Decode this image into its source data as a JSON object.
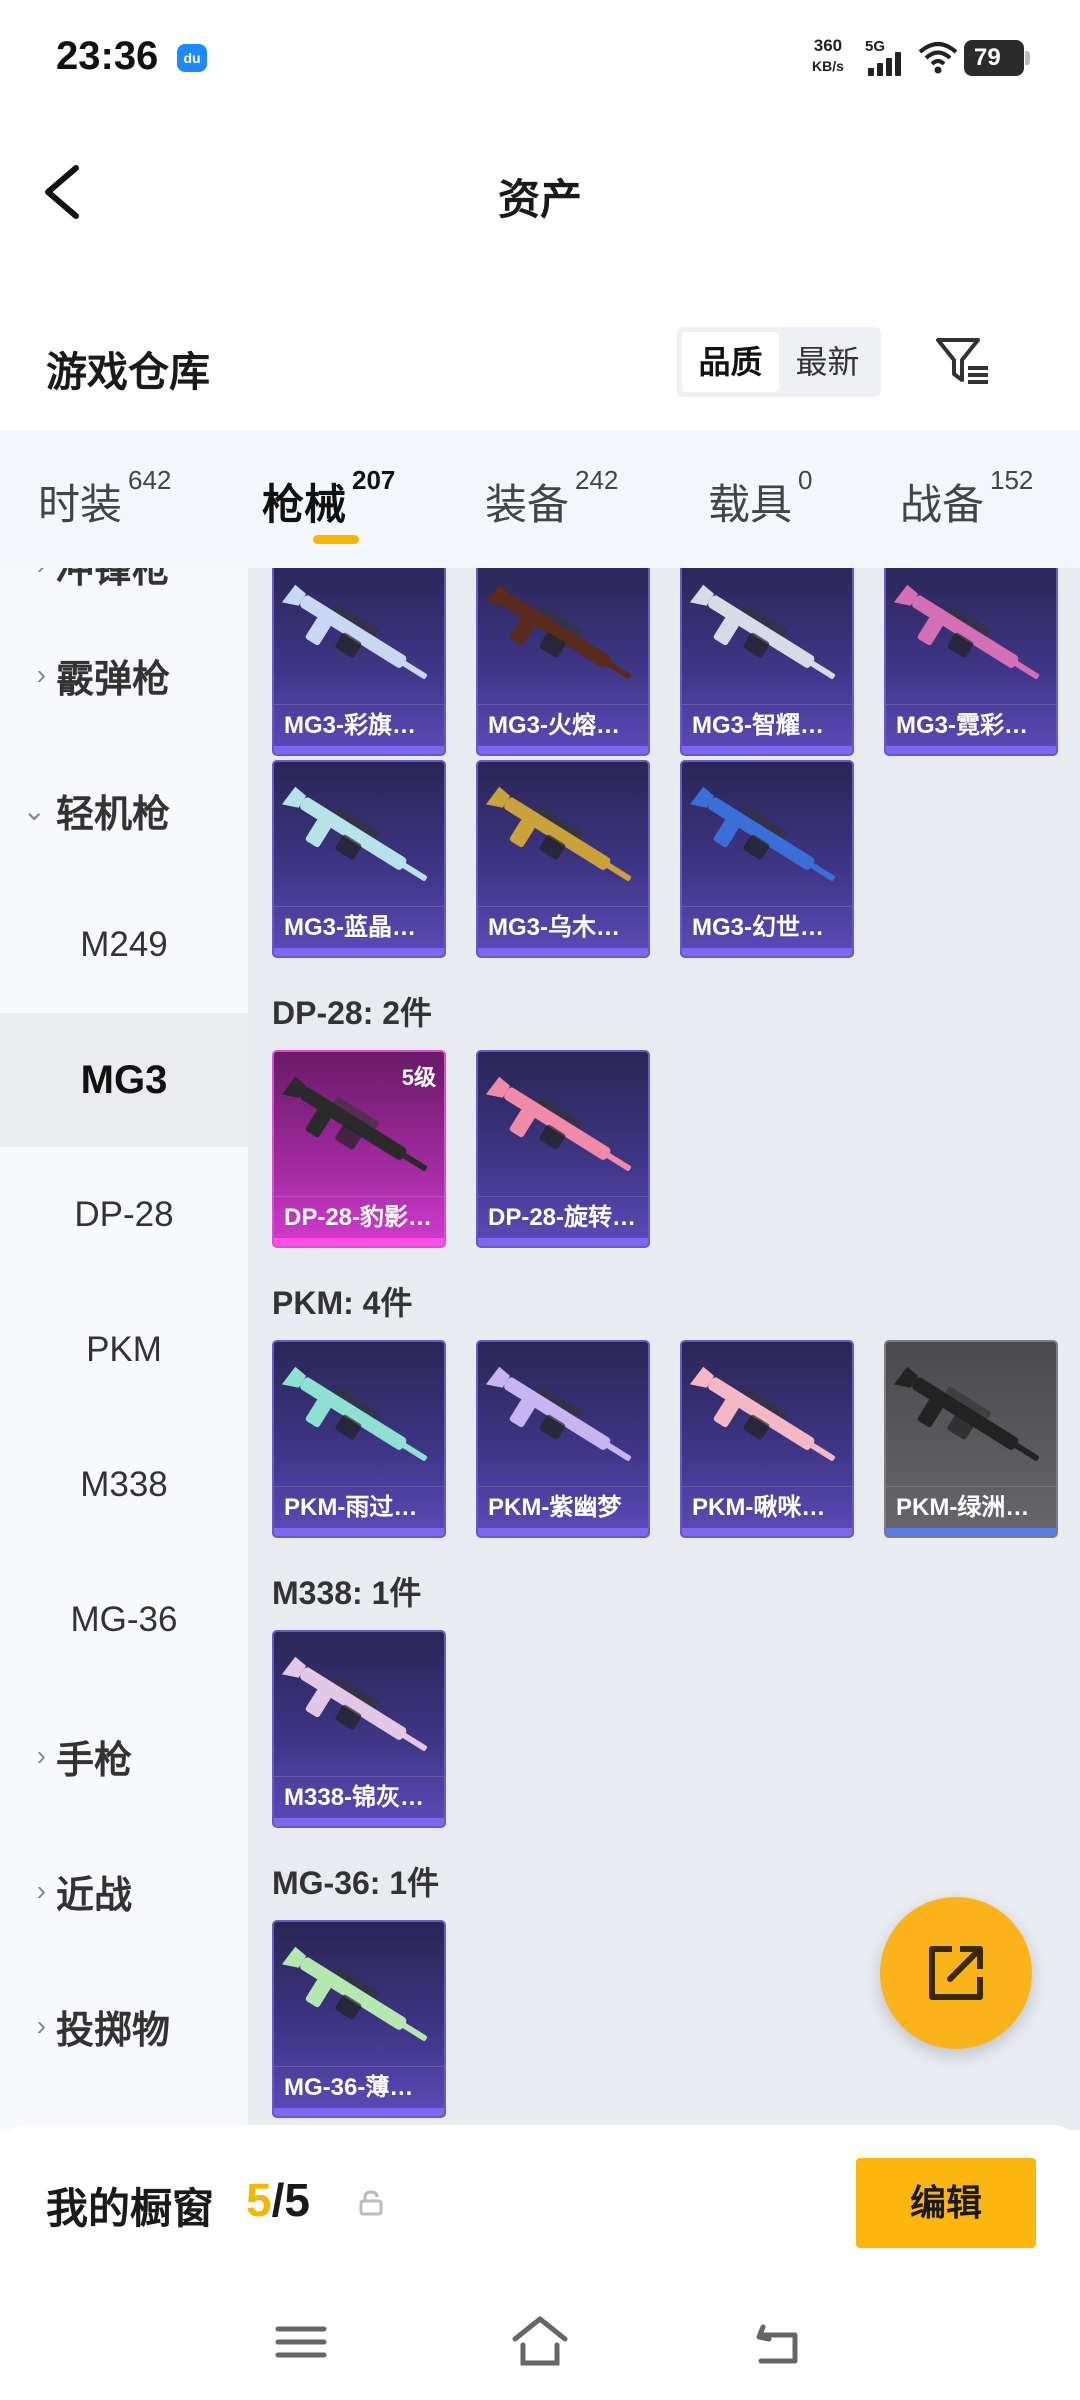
{
  "status_bar": {
    "time": "23:36",
    "app_badge": "du",
    "net_speed_value": "360",
    "net_speed_unit": "KB/s",
    "network": "5G",
    "battery": "79"
  },
  "header": {
    "title": "资产"
  },
  "warehouse": {
    "title": "游戏仓库",
    "sort_options": [
      "品质",
      "最新"
    ],
    "active_sort": "品质"
  },
  "tabs": [
    {
      "label": "时装",
      "count": "642"
    },
    {
      "label": "枪械",
      "count": "207",
      "active": true
    },
    {
      "label": "装备",
      "count": "242"
    },
    {
      "label": "载具",
      "count": "0"
    },
    {
      "label": "战备",
      "count": "152"
    }
  ],
  "sidebar": [
    {
      "label": "冲锋枪",
      "type": "category"
    },
    {
      "label": "霰弹枪",
      "type": "category"
    },
    {
      "label": "轻机枪",
      "type": "category",
      "expanded": true
    },
    {
      "label": "M249",
      "type": "sub"
    },
    {
      "label": "MG3",
      "type": "sub",
      "selected": true
    },
    {
      "label": "DP-28",
      "type": "sub"
    },
    {
      "label": "PKM",
      "type": "sub"
    },
    {
      "label": "M338",
      "type": "sub"
    },
    {
      "label": "MG-36",
      "type": "sub"
    },
    {
      "label": "手枪",
      "type": "category"
    },
    {
      "label": "近战",
      "type": "category"
    },
    {
      "label": "投掷物",
      "type": "category"
    }
  ],
  "groups": {
    "mg3": {
      "items": [
        {
          "name": "MG3-彩旗…",
          "gun_color": "#c9d7f2"
        },
        {
          "name": "MG3-火熔…",
          "gun_color": "#5a2a1c"
        },
        {
          "name": "MG3-智耀…",
          "gun_color": "#d6dbe6"
        },
        {
          "name": "MG3-霓彩…",
          "gun_color": "#d56fb5"
        },
        {
          "name": "MG3-蓝晶…",
          "gun_color": "#b8e2ea"
        },
        {
          "name": "MG3-乌木…",
          "gun_color": "#c9a23a"
        },
        {
          "name": "MG3-幻世…",
          "gun_color": "#3b6fd8"
        }
      ]
    },
    "dp28": {
      "title": "DP-28: 2件",
      "items": [
        {
          "name": "DP-28-豹影…",
          "level": "5级",
          "rarity": "pink",
          "gun_color": "#2a2a2a"
        },
        {
          "name": "DP-28-旋转…",
          "gun_color": "#f08aa8"
        }
      ]
    },
    "pkm": {
      "title": "PKM: 4件",
      "items": [
        {
          "name": "PKM-雨过…",
          "gun_color": "#8ee0d2"
        },
        {
          "name": "PKM-紫幽梦",
          "gun_color": "#c7b4f0"
        },
        {
          "name": "PKM-啾咪…",
          "gun_color": "#f4b7c4"
        },
        {
          "name": "PKM-绿洲…",
          "rarity": "gray",
          "gun_color": "#232323"
        }
      ]
    },
    "m338": {
      "title": "M338: 1件",
      "items": [
        {
          "name": "M338-锦灰…",
          "gun_color": "#e3c7e6"
        }
      ]
    },
    "mg36": {
      "title": "MG-36: 1件",
      "items": [
        {
          "name": "MG-36-薄…",
          "gun_color": "#b5e8b0"
        }
      ]
    }
  },
  "showcase": {
    "title": "我的橱窗",
    "current": "5",
    "total": "/5",
    "edit_label": "编辑"
  },
  "colors": {
    "accent": "#f7b500",
    "fab": "#fbb31c"
  }
}
